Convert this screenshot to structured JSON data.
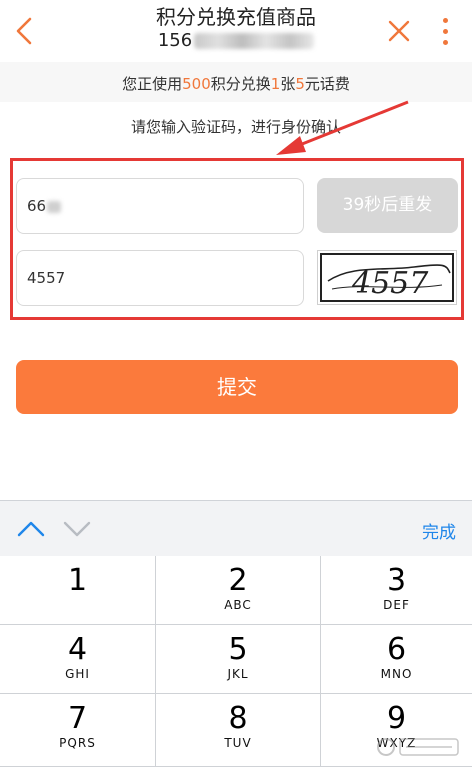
{
  "header": {
    "title": "积分兑换充值商品",
    "subtitle_visible": "156"
  },
  "exchange_info": {
    "prefix": "您正使用",
    "points": "500",
    "middle": "积分兑换",
    "count": "1",
    "unit_card": "张",
    "amount": "5",
    "suffix": "元话费"
  },
  "verify_prompt": "请您输入验证码，进行身份确认",
  "sms_code_field": {
    "value_visible": "66"
  },
  "resend_button": {
    "label": "39秒后重发"
  },
  "captcha_field": {
    "value": "4557"
  },
  "captcha_image": {
    "text": "4557"
  },
  "submit_button": {
    "label": "提交"
  },
  "keyboard": {
    "done_label": "完成",
    "keys": [
      {
        "digit": "1",
        "letters": ""
      },
      {
        "digit": "2",
        "letters": "ABC"
      },
      {
        "digit": "3",
        "letters": "DEF"
      },
      {
        "digit": "4",
        "letters": "GHI"
      },
      {
        "digit": "5",
        "letters": "JKL"
      },
      {
        "digit": "6",
        "letters": "MNO"
      },
      {
        "digit": "7",
        "letters": "PQRS"
      },
      {
        "digit": "8",
        "letters": "TUV"
      },
      {
        "digit": "9",
        "letters": "WXYZ"
      }
    ]
  },
  "colors": {
    "accent": "#f0773b",
    "submit": "#fb7a3c",
    "highlight_box": "#e53935",
    "done": "#1f86ea"
  }
}
